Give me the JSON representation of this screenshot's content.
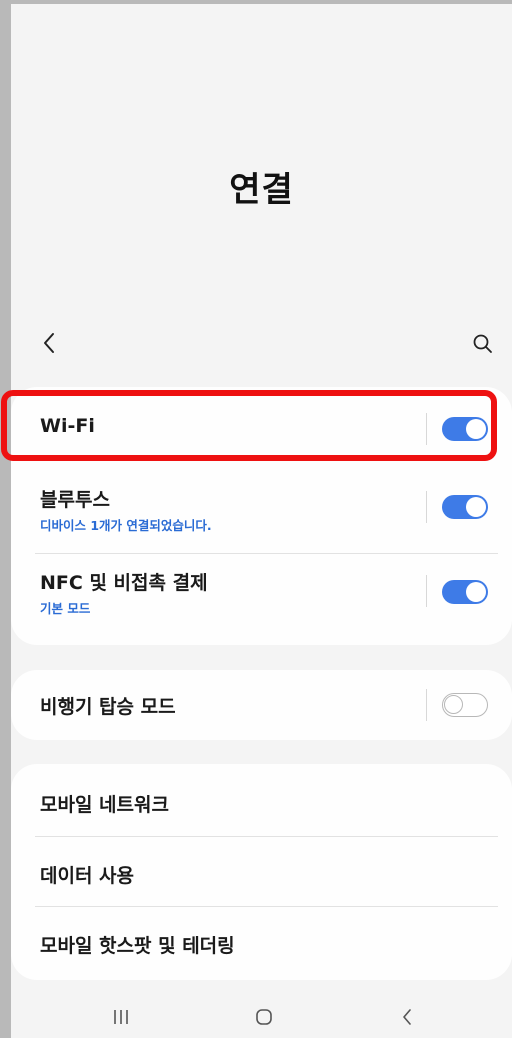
{
  "header": {
    "title": "연결"
  },
  "toolbar": {
    "back_icon": "chevron-left-icon",
    "search_icon": "search-icon"
  },
  "sections": [
    {
      "items": [
        {
          "title": "Wi-Fi",
          "subtitle": "",
          "toggle": true,
          "highlighted": true
        },
        {
          "title": "블루투스",
          "subtitle": "디바이스 1개가 연결되었습니다.",
          "toggle": true
        },
        {
          "title": "NFC 및 비접촉 결제",
          "subtitle": "기본 모드",
          "toggle": true
        }
      ]
    },
    {
      "items": [
        {
          "title": "비행기 탑승 모드",
          "subtitle": "",
          "toggle": false
        }
      ]
    },
    {
      "items": [
        {
          "title": "모바일 네트워크"
        },
        {
          "title": "데이터 사용"
        },
        {
          "title": "모바일 핫스팟 및 테더링"
        }
      ]
    }
  ],
  "navbar": {
    "recent_icon": "recent-apps-icon",
    "home_icon": "home-icon",
    "back_icon": "back-icon"
  },
  "colors": {
    "accent": "#3e7be7",
    "subtitle": "#2a6bd4",
    "highlight": "#ee1111",
    "background": "#f4f4f4",
    "card": "#fefefe"
  }
}
